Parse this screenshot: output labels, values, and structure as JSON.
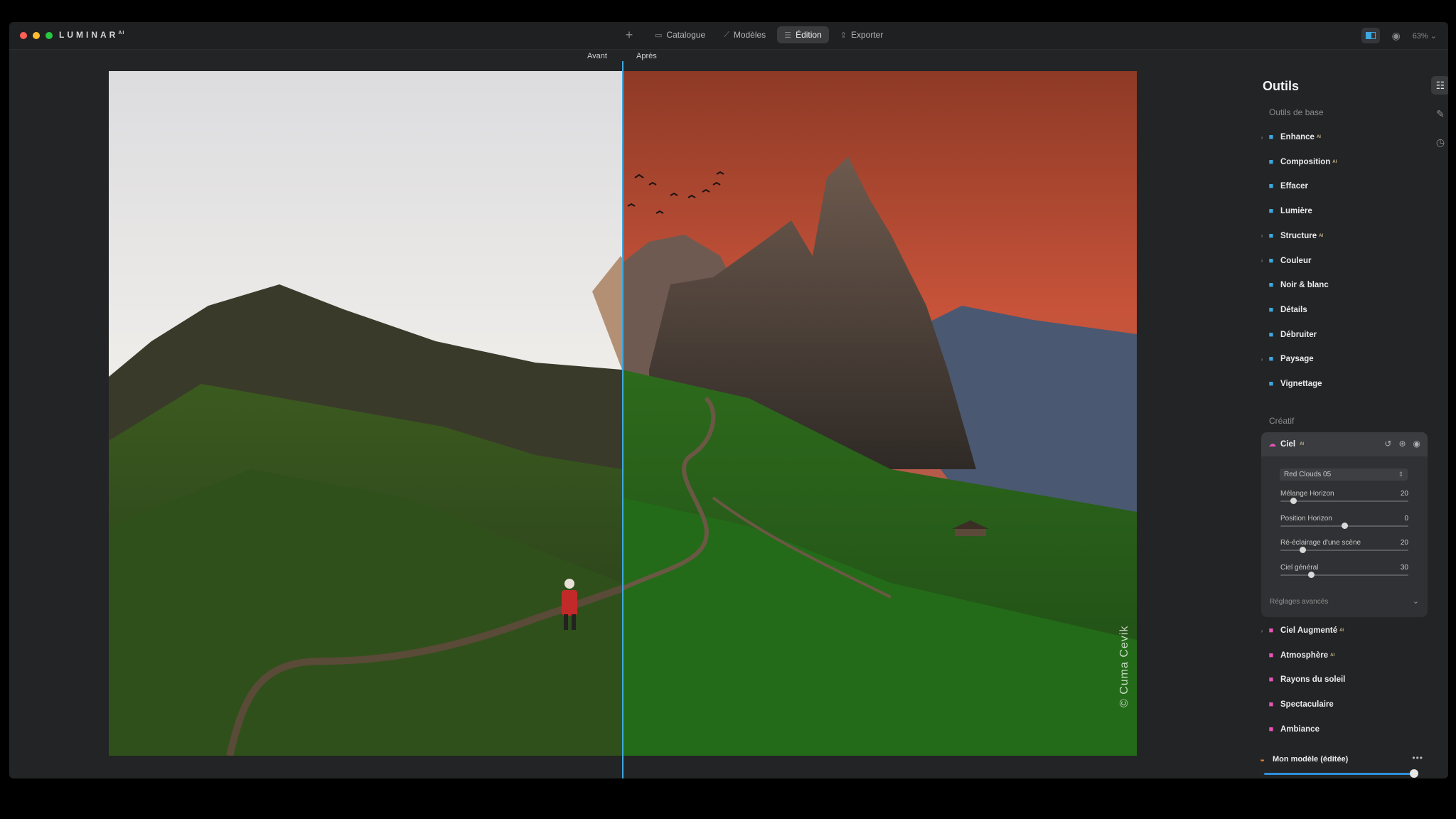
{
  "app": {
    "brand": "LUMINAR",
    "brand_sup": "AI"
  },
  "nav": {
    "tabs": [
      {
        "label": "Catalogue",
        "icon": "folder-icon"
      },
      {
        "label": "Modèles",
        "icon": "templates-icon"
      },
      {
        "label": "Édition",
        "icon": "sliders-icon"
      },
      {
        "label": "Exporter",
        "icon": "share-icon"
      }
    ],
    "active": "Édition",
    "zoom": "63%"
  },
  "canvas": {
    "before_label": "Avant",
    "after_label": "Après",
    "watermark": "© Cuma Cevik"
  },
  "panel": {
    "title": "Outils",
    "sections": {
      "basic": "Outils de base",
      "creative": "Créatif"
    },
    "basic_tools": [
      {
        "label": "Enhance",
        "badge": "AI",
        "icon": "enhance-icon",
        "color": "#3fa7e0"
      },
      {
        "label": "Composition",
        "badge": "AI",
        "icon": "crop-icon",
        "color": "#3fa7e0"
      },
      {
        "label": "Effacer",
        "badge": "",
        "icon": "eraser-icon",
        "color": "#3fa7e0"
      },
      {
        "label": "Lumière",
        "badge": "",
        "icon": "sun-icon",
        "color": "#3fa7e0"
      },
      {
        "label": "Structure",
        "badge": "AI",
        "icon": "structure-icon",
        "color": "#3fa7e0"
      },
      {
        "label": "Couleur",
        "badge": "",
        "icon": "color-icon",
        "color": "#3fa7e0"
      },
      {
        "label": "Noir & blanc",
        "badge": "",
        "icon": "bw-icon",
        "color": "#3fa7e0"
      },
      {
        "label": "Détails",
        "badge": "",
        "icon": "details-icon",
        "color": "#3fa7e0"
      },
      {
        "label": "Débruiter",
        "badge": "",
        "icon": "denoise-icon",
        "color": "#3fa7e0"
      },
      {
        "label": "Paysage",
        "badge": "",
        "icon": "landscape-icon",
        "color": "#3fa7e0"
      },
      {
        "label": "Vignettage",
        "badge": "",
        "icon": "vignette-icon",
        "color": "#3fa7e0"
      }
    ],
    "ciel": {
      "label": "Ciel",
      "badge": "AI",
      "sky_select": "Red Clouds 05",
      "sliders": [
        {
          "label": "Mélange Horizon",
          "value": "20",
          "fraction": 0.1
        },
        {
          "label": "Position Horizon",
          "value": "0",
          "fraction": 0.5
        },
        {
          "label": "Ré-éclairage d'une scène",
          "value": "20",
          "fraction": 0.17
        },
        {
          "label": "Ciel général",
          "value": "30",
          "fraction": 0.24
        }
      ],
      "advanced": "Réglages avancés"
    },
    "creative_tools": [
      {
        "label": "Ciel Augmenté",
        "badge": "AI",
        "icon": "cloud-icon",
        "color": "#e455b6"
      },
      {
        "label": "Atmosphère",
        "badge": "AI",
        "icon": "atmosphere-icon",
        "color": "#e455b6"
      },
      {
        "label": "Rayons du soleil",
        "badge": "",
        "icon": "sunrays-icon",
        "color": "#e455b6"
      },
      {
        "label": "Spectaculaire",
        "badge": "",
        "icon": "bolt-icon",
        "color": "#e455b6"
      },
      {
        "label": "Ambiance",
        "badge": "",
        "icon": "mood-icon",
        "color": "#e455b6"
      }
    ],
    "preset": {
      "label": "Mon modèle (éditée)",
      "amount": 1.0
    }
  },
  "colors": {
    "accent": "#3fa7e0",
    "creative": "#e455b6"
  }
}
